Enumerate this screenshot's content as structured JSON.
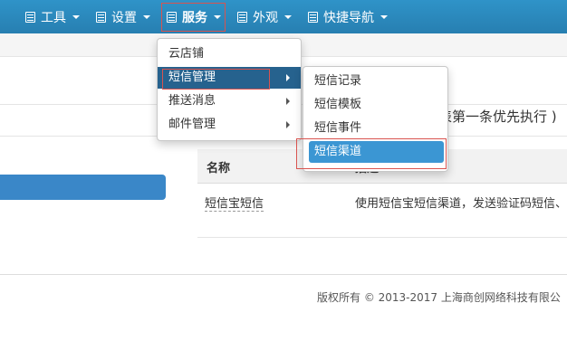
{
  "nav": {
    "items": [
      {
        "label": "工具"
      },
      {
        "label": "设置"
      },
      {
        "label": "服务"
      },
      {
        "label": "外观"
      },
      {
        "label": "快捷导航"
      }
    ]
  },
  "hint_text": "表第一条优先执行 )",
  "table": {
    "headers": [
      "名称",
      "描述"
    ],
    "row": {
      "name": "短信宝短信",
      "desc": "使用短信宝短信渠道，发送验证码短信、"
    }
  },
  "footer": "版权所有 © 2013-2017 上海商创网络科技有限公",
  "menu_service": {
    "items": [
      {
        "label": "云店铺"
      },
      {
        "label": "短信管理"
      },
      {
        "label": "推送消息"
      },
      {
        "label": "邮件管理"
      }
    ]
  },
  "menu_sms": {
    "items": [
      {
        "label": "短信记录"
      },
      {
        "label": "短信模板"
      },
      {
        "label": "短信事件"
      },
      {
        "label": "短信渠道"
      }
    ]
  },
  "colors": {
    "nav_bg": "#2b8bbf",
    "selected": "#26628e",
    "highlight": "#3b96d3",
    "outline": "#d9534f"
  }
}
